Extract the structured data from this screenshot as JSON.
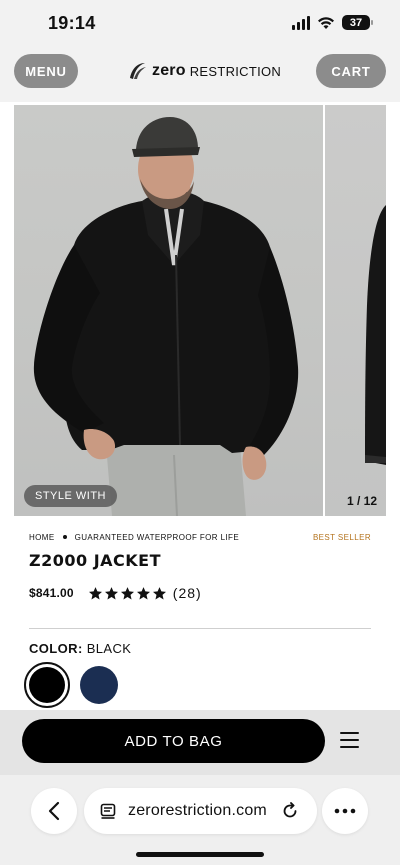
{
  "status_bar": {
    "time": "19:14",
    "battery": "37"
  },
  "header": {
    "menu_label": "MENU",
    "cart_label": "CART",
    "logo_bold": "zero",
    "logo_thin": "RESTRICTION"
  },
  "gallery": {
    "style_with_label": "STYLE WITH",
    "counter": "1 / 12"
  },
  "breadcrumb": {
    "home": "HOME",
    "tagline": "GUARANTEED WATERPROOF FOR LIFE",
    "badge": "BEST SELLER"
  },
  "product": {
    "title": "Z2000 JACKET",
    "price": "$841.00",
    "rating_stars": 5,
    "reviews": "(28)",
    "color_label": "COLOR:",
    "color_value": "BLACK",
    "swatches": [
      {
        "name": "black",
        "hex": "#000000"
      },
      {
        "name": "navy",
        "hex": "#1b2e52"
      }
    ]
  },
  "actions": {
    "add_to_bag": "ADD TO BAG"
  },
  "browser": {
    "url": "zerorestriction.com"
  },
  "colors": {
    "accent_gold": "#b4731e",
    "pill_gray": "#8c8c8c"
  }
}
